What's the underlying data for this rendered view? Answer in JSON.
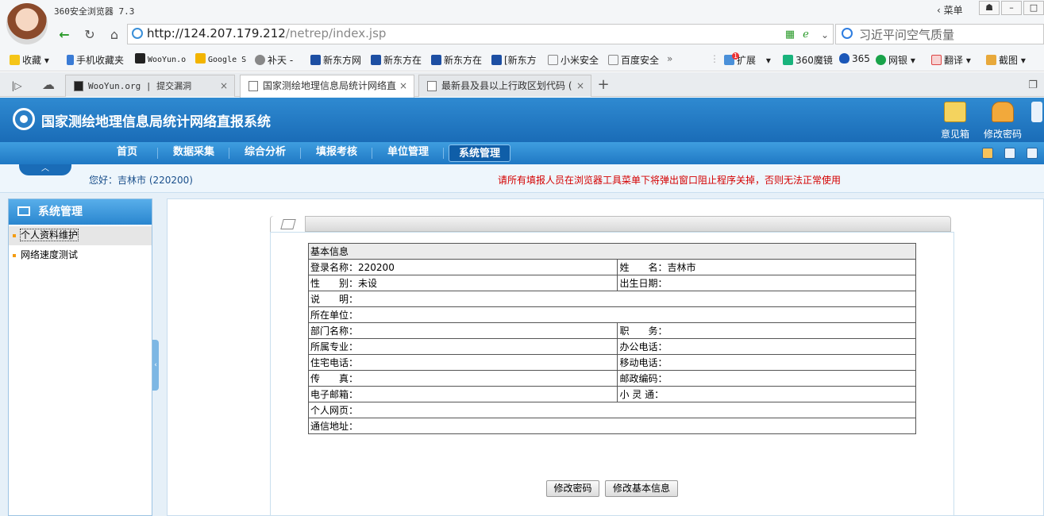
{
  "browser": {
    "title": "360安全浏览器 7.3",
    "menu_label": "菜单",
    "address_host": "http://124.207.179.212",
    "address_path": "/netrep/index.jsp",
    "search_text": "习近平问空气质量",
    "bookmarks": [
      "收藏",
      "手机收藏夹",
      "WooYun.o",
      "Google S",
      "补天 -",
      "新东方网",
      "新东方在",
      "新东方在",
      "[新东方",
      "小米安全",
      "百度安全",
      "扩展",
      "360魔镜",
      "365",
      "网银",
      "翻译",
      "截图"
    ],
    "extension_badge": "1",
    "tabs": [
      {
        "label": "WooYun.org | 提交漏洞"
      },
      {
        "label": "国家测绘地理信息局统计网络直"
      },
      {
        "label": "最新县及县以上行政区划代码 ("
      }
    ],
    "new_tab_label": "+"
  },
  "app": {
    "name": "国家测绘地理信息局统计网络直报系统",
    "tools": [
      "意见箱",
      "修改密码"
    ],
    "nav": [
      "首页",
      "数据采集",
      "综合分析",
      "填报考核",
      "单位管理",
      "系统管理"
    ],
    "nav_active": "系统管理",
    "greeting": "您好：吉林市 (220200)",
    "notice": "请所有填报人员在浏览器工具菜单下将弹出窗口阻止程序关掉，否则无法正常使用"
  },
  "sidebar": {
    "title": "系统管理",
    "items": [
      "个人资料维护",
      "网络速度测试"
    ]
  },
  "form": {
    "section_title": "基本信息",
    "rows": [
      {
        "l1": "登录名称：",
        "v1": "220200",
        "l2": "姓　　名：",
        "v2": "吉林市"
      },
      {
        "l1": "性　　别：",
        "v1": "未设",
        "l2": "出生日期：",
        "v2": ""
      },
      {
        "l1": "说　　明：",
        "v1": "",
        "l2": null,
        "v2": null
      },
      {
        "l1": "所在单位：",
        "v1": "",
        "l2": null,
        "v2": null
      },
      {
        "l1": "部门名称：",
        "v1": "",
        "l2": "职　　务：",
        "v2": ""
      },
      {
        "l1": "所属专业：",
        "v1": "",
        "l2": "办公电话：",
        "v2": ""
      },
      {
        "l1": "住宅电话：",
        "v1": "",
        "l2": "移动电话：",
        "v2": ""
      },
      {
        "l1": "传　　真：",
        "v1": "",
        "l2": "邮政编码：",
        "v2": ""
      },
      {
        "l1": "电子邮箱：",
        "v1": "",
        "l2": "小 灵 通：",
        "v2": ""
      },
      {
        "l1": "个人网页：",
        "v1": "",
        "l2": null,
        "v2": null
      },
      {
        "l1": "通信地址：",
        "v1": "",
        "l2": null,
        "v2": null
      }
    ],
    "buttons": {
      "change_password": "修改密码",
      "change_info": "修改基本信息"
    }
  },
  "colors": {
    "header_blue": "#1a6cb7",
    "notice_red": "#d40000",
    "sidebar_bullet": "#f39c12"
  }
}
